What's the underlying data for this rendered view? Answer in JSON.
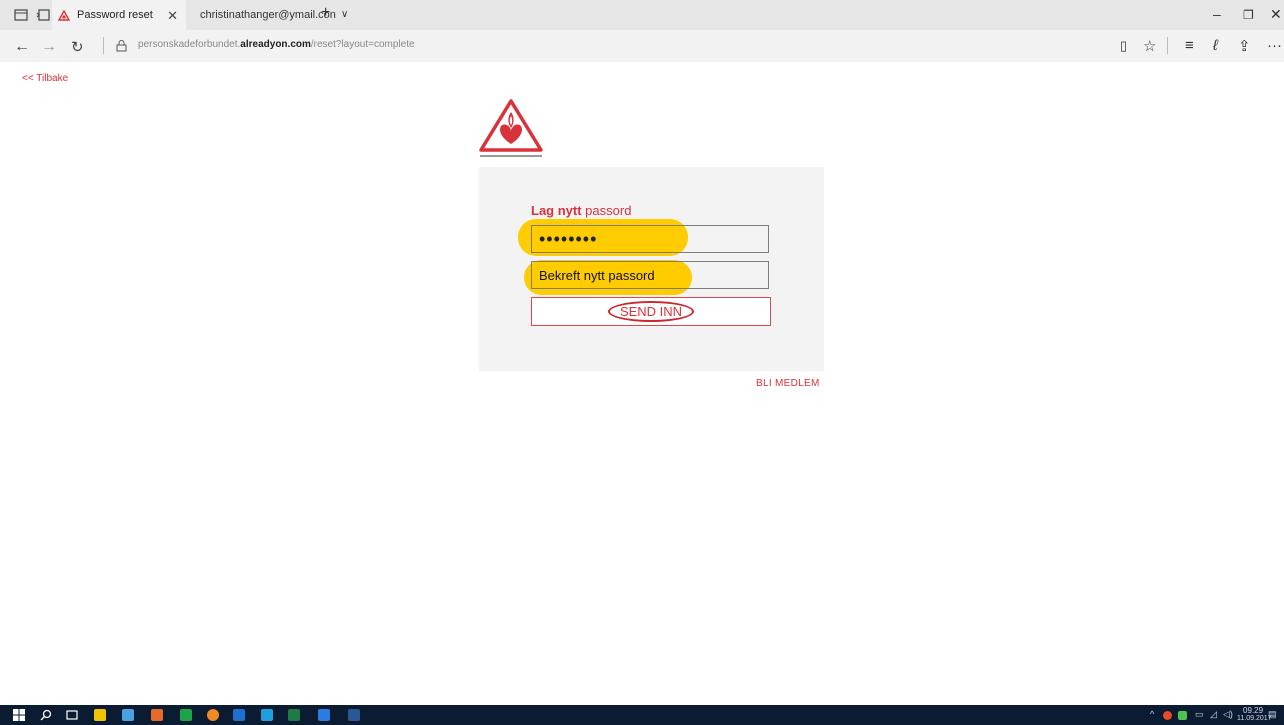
{
  "browser": {
    "tabs": [
      {
        "title": "Password reset",
        "active": true
      },
      {
        "title": "christinathanger@ymail.con",
        "active": false
      }
    ],
    "url": {
      "prefix": "personskadeforbundet.",
      "domain": "alreadyon.com",
      "path": "/reset?layout=complete"
    }
  },
  "page": {
    "back_link": "<< Tilbake",
    "form_title_bold": "Lag nytt",
    "form_title_rest": " passord",
    "password_value": "••••••••",
    "confirm_placeholder": "Bekreft nytt passord",
    "submit_label": "SEND INN",
    "join_link": "BLI MEDLEM"
  },
  "taskbar": {
    "time": "09.29",
    "date": "11.09.2017"
  },
  "colors": {
    "accent": "#d9323a",
    "highlight": "#ffcc00",
    "panel": "#f3f3f3",
    "taskbar": "#0b1b31"
  },
  "icons": [
    "tab-list-icon",
    "tab-back-icon",
    "logo-icon",
    "mail-icon",
    "close-icon",
    "new-tab-icon",
    "chevron-down-icon",
    "minimize-icon",
    "maximize-icon",
    "back-arrow-icon",
    "forward-arrow-icon",
    "refresh-icon",
    "lock-icon",
    "reading-view-icon",
    "favorites-star-icon",
    "hub-icon",
    "pen-icon",
    "share-icon",
    "more-icon",
    "windows-start-icon",
    "search-icon",
    "task-view-icon"
  ]
}
